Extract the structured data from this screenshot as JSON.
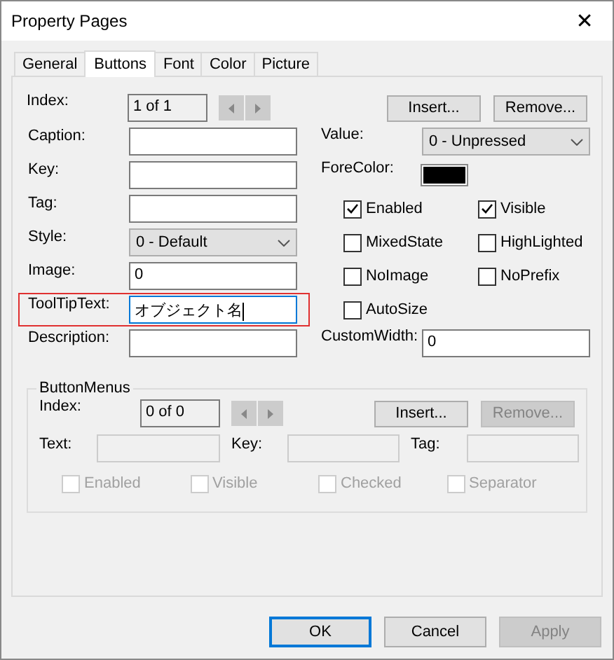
{
  "window": {
    "title": "Property Pages",
    "close": "✕"
  },
  "tabs": [
    {
      "label": "General",
      "selected": false
    },
    {
      "label": "Buttons",
      "selected": true
    },
    {
      "label": "Font",
      "selected": false
    },
    {
      "label": "Color",
      "selected": false
    },
    {
      "label": "Picture",
      "selected": false
    }
  ],
  "index": {
    "label": "Index:",
    "value": "1 of 1"
  },
  "index_buttons": [
    {
      "label": "Insert...",
      "disabled": false
    },
    {
      "label": "Remove...",
      "disabled": false
    }
  ],
  "fields": [
    {
      "label": "Caption:",
      "kind": "text"
    },
    {
      "label": "Key:",
      "kind": "text"
    },
    {
      "label": "Tag:",
      "kind": "text"
    },
    {
      "label": "Style:",
      "kind": "select",
      "value": "0 - Default"
    },
    {
      "label": "Image:",
      "kind": "text",
      "value": "0"
    },
    {
      "label": "ToolTipText:",
      "kind": "text",
      "value": "オブジェクト名",
      "focused": true,
      "highlighted": true
    },
    {
      "label": "Description:",
      "kind": "text"
    }
  ],
  "value": {
    "label": "Value:",
    "value": "0 - Unpressed"
  },
  "fore_color": {
    "label": "ForeColor:",
    "color": "#000000"
  },
  "options": [
    {
      "label": "Enabled",
      "checked": true
    },
    {
      "label": "Visible",
      "checked": true
    },
    {
      "label": "MixedState",
      "checked": false
    },
    {
      "label": "HighLighted",
      "checked": false
    },
    {
      "label": "NoImage",
      "checked": false
    },
    {
      "label": "NoPrefix",
      "checked": false
    },
    {
      "label": "AutoSize",
      "checked": false
    }
  ],
  "custom_width": {
    "label": "CustomWidth:",
    "value": "0"
  },
  "button_menus": {
    "title": "ButtonMenus",
    "index": {
      "label": "Index:",
      "value": "0 of 0"
    },
    "buttons": [
      {
        "label": "Insert...",
        "disabled": false
      },
      {
        "label": "Remove...",
        "disabled": true
      }
    ],
    "fields": [
      {
        "label": "Text:"
      },
      {
        "label": "Key:"
      },
      {
        "label": "Tag:"
      }
    ],
    "options": [
      {
        "label": "Enabled",
        "checked": false,
        "disabled": true
      },
      {
        "label": "Visible",
        "checked": false,
        "disabled": true
      },
      {
        "label": "Checked",
        "checked": false,
        "disabled": true
      },
      {
        "label": "Separator",
        "checked": false,
        "disabled": true
      }
    ]
  },
  "footer_buttons": [
    {
      "label": "OK",
      "default": true,
      "disabled": false
    },
    {
      "label": "Cancel",
      "default": false,
      "disabled": false
    },
    {
      "label": "Apply",
      "default": false,
      "disabled": true
    }
  ]
}
